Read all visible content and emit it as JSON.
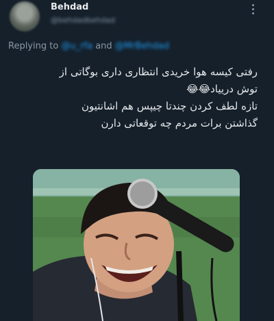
{
  "tweet": {
    "author": {
      "display_name": "Behdad",
      "handle": "@behdadbehdad"
    },
    "reply": {
      "label": "Replying to",
      "mention_1": "@u_rfa",
      "conjunction": "and",
      "mention_2": "@MrBehdad"
    },
    "text_lines": [
      "رفتی کیسه هوا خریدی انتظاری داری بوگاتی از",
      "توش درییاد😂😂",
      "تازه لطف کردن چندتا چیپس هم اشانتیون",
      "گذاشتن برات مردم چه توقعاتی دارن"
    ],
    "media": {
      "description_icon": "laughing-man-with-microphone-image"
    }
  },
  "colors": {
    "background": "#15202b",
    "text_primary": "#e7e9ea",
    "text_secondary": "#8b98a5",
    "link": "#1d9bf0"
  },
  "icons": {
    "more": "more-vertical-icon"
  }
}
